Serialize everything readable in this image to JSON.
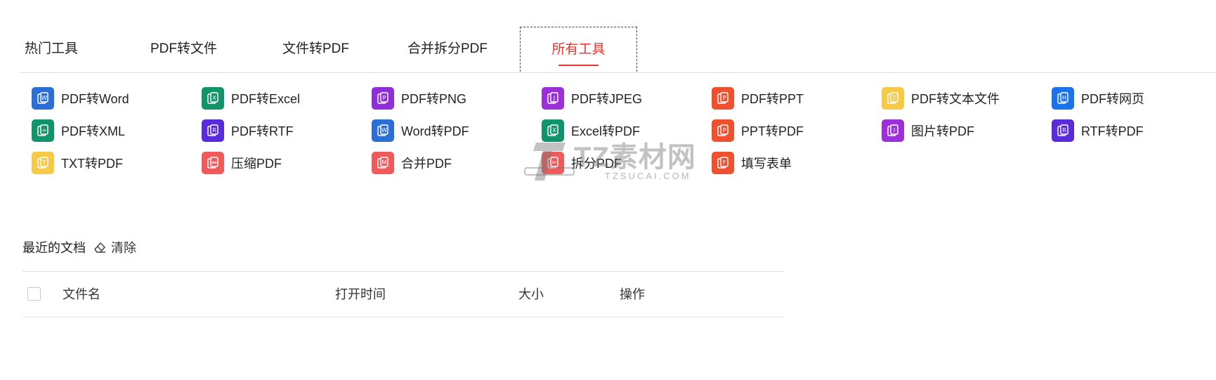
{
  "tabs": [
    {
      "label": "热门工具"
    },
    {
      "label": "PDF转文件"
    },
    {
      "label": "文件转PDF"
    },
    {
      "label": "合并拆分PDF"
    },
    {
      "label": "所有工具"
    }
  ],
  "active_tab": "所有工具",
  "tools": [
    {
      "label": "PDF转Word",
      "icon": "pdf-to-word-icon",
      "color": "#2b6fd6"
    },
    {
      "label": "PDF转Excel",
      "icon": "pdf-to-excel-icon",
      "color": "#13936a"
    },
    {
      "label": "PDF转PNG",
      "icon": "pdf-to-png-icon",
      "color": "#8f2fd8"
    },
    {
      "label": "PDF转JPEG",
      "icon": "pdf-to-jpeg-icon",
      "color": "#9b2fd8"
    },
    {
      "label": "PDF转PPT",
      "icon": "pdf-to-ppt-icon",
      "color": "#ee5030"
    },
    {
      "label": "PDF转文本文件",
      "icon": "pdf-to-text-icon",
      "color": "#f7c948"
    },
    {
      "label": "PDF转网页",
      "icon": "pdf-to-html-icon",
      "color": "#1a73e8"
    },
    {
      "label": "PDF转XML",
      "icon": "pdf-to-xml-icon",
      "color": "#13936a"
    },
    {
      "label": "PDF转RTF",
      "icon": "pdf-to-rtf-icon",
      "color": "#5a2bd8"
    },
    {
      "label": "Word转PDF",
      "icon": "word-to-pdf-icon",
      "color": "#2b6fd6"
    },
    {
      "label": "Excel转PDF",
      "icon": "excel-to-pdf-icon",
      "color": "#13936a"
    },
    {
      "label": "PPT转PDF",
      "icon": "ppt-to-pdf-icon",
      "color": "#ee5030"
    },
    {
      "label": "图片转PDF",
      "icon": "image-to-pdf-icon",
      "color": "#9b2fd8"
    },
    {
      "label": "RTF转PDF",
      "icon": "rtf-to-pdf-icon",
      "color": "#5a2bd8"
    },
    {
      "label": "TXT转PDF",
      "icon": "txt-to-pdf-icon",
      "color": "#f7c948"
    },
    {
      "label": "压缩PDF",
      "icon": "compress-pdf-icon",
      "color": "#ef5a5a"
    },
    {
      "label": "合并PDF",
      "icon": "merge-pdf-icon",
      "color": "#ef5a5a"
    },
    {
      "label": "拆分PDF",
      "icon": "split-pdf-icon",
      "color": "#ef5a5a"
    },
    {
      "label": "填写表单",
      "icon": "fill-form-icon",
      "color": "#ee5030"
    }
  ],
  "watermark": {
    "text": "TZ素材网",
    "sub": "TZSUCAI.COM"
  },
  "recent": {
    "title": "最近的文档",
    "clear_label": "清除",
    "columns": {
      "name": "文件名",
      "opened": "打开时间",
      "size": "大小",
      "actions": "操作"
    }
  }
}
